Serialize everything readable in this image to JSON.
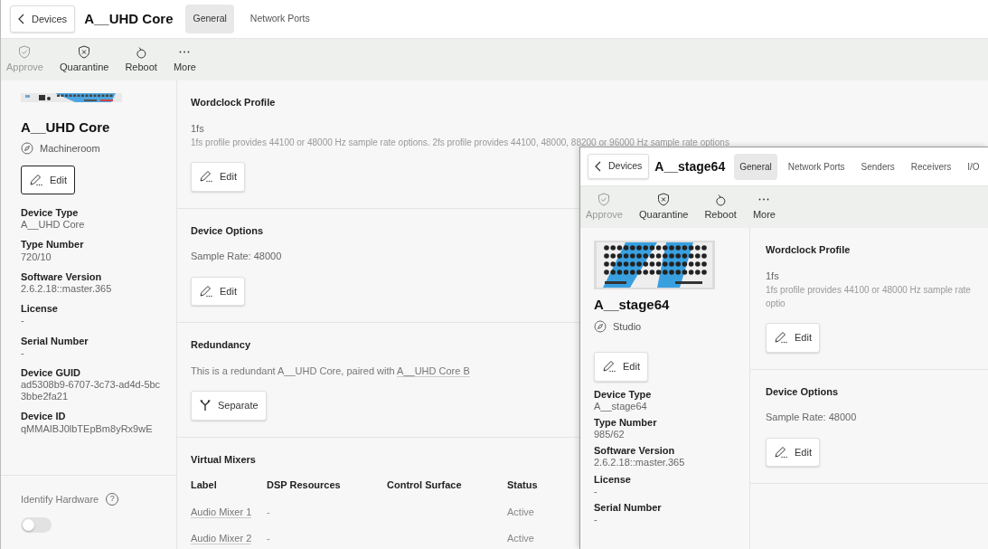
{
  "windows": [
    {
      "back": "Devices",
      "title": "A__UHD Core",
      "tabs": [
        {
          "label": "General",
          "selected": true
        },
        {
          "label": "Network Ports",
          "selected": false
        }
      ],
      "actions": [
        {
          "label": "Approve",
          "disabled": true
        },
        {
          "label": "Quarantine",
          "disabled": false
        },
        {
          "label": "Reboot",
          "disabled": false
        },
        {
          "label": "More",
          "disabled": false
        }
      ],
      "device": {
        "kind": "slim",
        "name": "A__UHD Core",
        "location": "Machineroom",
        "edit": "Edit",
        "properties": [
          {
            "label": "Device Type",
            "value": "A__UHD Core"
          },
          {
            "label": "Type Number",
            "value": "720/10"
          },
          {
            "label": "Software Version",
            "value": "2.6.2.18::master.365"
          },
          {
            "label": "License",
            "value": "-"
          },
          {
            "label": "Serial Number",
            "value": "-"
          },
          {
            "label": "Device GUID",
            "value": "ad5308b9-6707-3c73-ad4d-5bc3bbe2fa21"
          },
          {
            "label": "Device ID",
            "value": "qMMAIBJ0lbTEpBm8yRx9wE"
          }
        ],
        "identify": {
          "label": "Identify Hardware",
          "help": "?",
          "on": false
        }
      },
      "sections": [
        {
          "kind": "profile",
          "title": "Wordclock Profile",
          "value": "1fs",
          "description": "1fs profile provides 44100 or 48000 Hz sample rate options. 2fs profile provides 44100, 48000, 88200 or 96000 Hz sample rate options",
          "button": "Edit"
        },
        {
          "kind": "options",
          "title": "Device Options",
          "text": "Sample Rate:  48000",
          "button": "Edit"
        },
        {
          "kind": "redundancy",
          "title": "Redundancy",
          "text": "This is a redundant A__UHD Core, paired with",
          "link": "A__UHD Core B",
          "button": "Separate"
        },
        {
          "kind": "table",
          "title": "Virtual Mixers",
          "columns": [
            "Label",
            "DSP Resources",
            "Control Surface",
            "Status"
          ],
          "rows": [
            [
              "Audio Mixer 1",
              "-",
              "",
              "Active"
            ],
            [
              "Audio Mixer 2",
              "-",
              "",
              "Active"
            ]
          ]
        }
      ]
    },
    {
      "back": "Devices",
      "title": "A__stage64",
      "tabs": [
        {
          "label": "General",
          "selected": true
        },
        {
          "label": "Network Ports",
          "selected": false
        },
        {
          "label": "Senders",
          "selected": false
        },
        {
          "label": "Receivers",
          "selected": false
        },
        {
          "label": "I/O",
          "selected": false
        }
      ],
      "actions": [
        {
          "label": "Approve",
          "disabled": true
        },
        {
          "label": "Quarantine",
          "disabled": false
        },
        {
          "label": "Reboot",
          "disabled": false
        },
        {
          "label": "More",
          "disabled": false
        }
      ],
      "device": {
        "kind": "stagebox",
        "name": "A__stage64",
        "location": "Studio",
        "edit": "Edit",
        "properties": [
          {
            "label": "Device Type",
            "value": "A__stage64"
          },
          {
            "label": "Type Number",
            "value": "985/62"
          },
          {
            "label": "Software Version",
            "value": "2.6.2.18::master.365"
          },
          {
            "label": "License",
            "value": "-"
          },
          {
            "label": "Serial Number",
            "value": "-"
          }
        ]
      },
      "sections": [
        {
          "kind": "profile",
          "title": "Wordclock Profile",
          "value": "1fs",
          "description": "1fs profile provides 44100 or 48000 Hz sample rate optio",
          "button": "Edit"
        },
        {
          "kind": "options",
          "title": "Device Options",
          "text": "Sample Rate:  48000",
          "button": "Edit"
        }
      ]
    }
  ]
}
